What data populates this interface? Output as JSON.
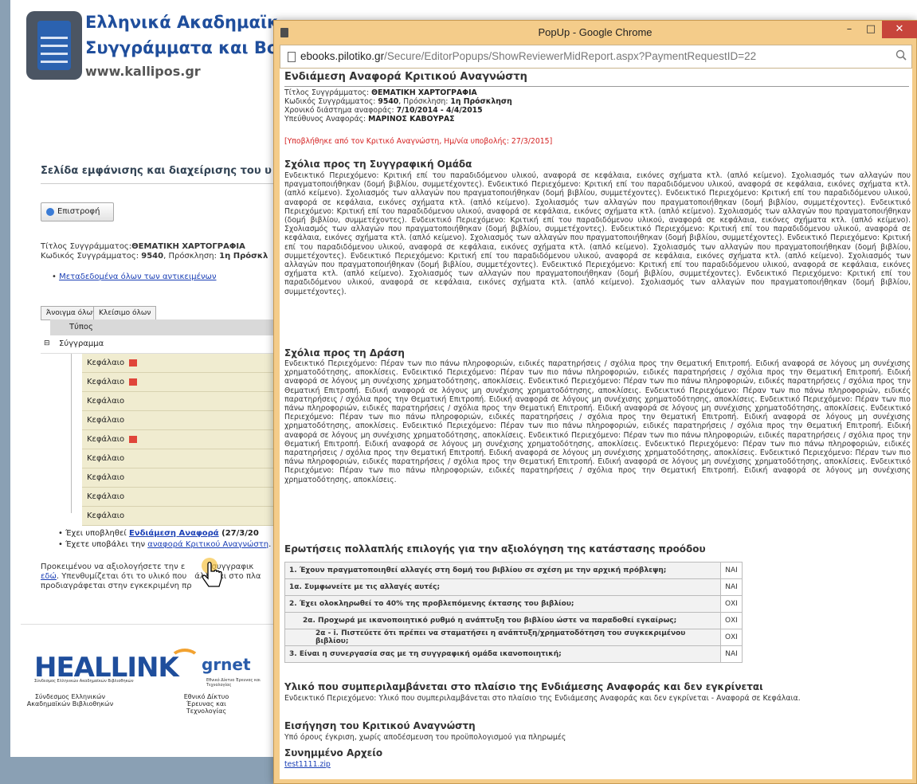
{
  "background": {
    "site_title_1": "Ελληνικά Ακαδημαϊκά Η",
    "site_title_2": "Συγγράμματα και Βοηθ",
    "site_url": "www.kallipos.gr",
    "heading": "Σελίδα εμφάνισης και διαχείρισης του υ",
    "back_button": "Επιστροφή",
    "title_label": "Τίτλος Συγγράμματος:",
    "title_value": "ΘΕΜΑΤΙΚΗ ΧΑΡΤΟΓΡΑΦΙΑ",
    "code_label": "Κωδικός Συγγράμματος: ",
    "code_value": "9540",
    "code_suffix": ", Πρόσκληση: ",
    "call_value": "1η Πρόσκλ",
    "metadata_link": "Μεταδεδομένα όλων των αντικειμένων",
    "open_all": "Άνοιγμα όλων",
    "close_all": "Κλείσιμο όλων",
    "col_type": "Τύπος",
    "root_item": "Σύγγραμμα",
    "chapters": [
      "Κεφάλαιο",
      "Κεφάλαιο",
      "Κεφάλαιο",
      "Κεφάλαιο",
      "Κεφάλαιο",
      "Κεφάλαιο",
      "Κεφάλαιο",
      "Κεφάλαιο",
      "Κεφάλαιο"
    ],
    "bullet1_prefix": "Έχει υποβληθεί ",
    "bullet1_link": "Ενδιάμεση Αναφορά",
    "bullet1_suffix": " (27/3/20",
    "bullet2_prefix": "Έχετε υποβάλει την ",
    "bullet2_link": "αναφορά Κριτικού Αναγνώστη",
    "bullet2_suffix": ". Μ",
    "para1": "Προκειμένου να αξιολογήσετε την ε",
    "para1b": " συγγραφικ",
    "para2_link": "εδώ",
    "para2": ". Υπενθυμίζεται ότι το υλικό που",
    "para2b": "άλλεται στο πλα",
    "para3": "προδιαγράφεται στην εγκεκριμένη πρ",
    "heal_brand": "HEALLINK",
    "heal_sub": "Σύνδεσμος Ελληνικών Ακαδημαϊκών Βιβλιοθηκών",
    "heal_label_1": "Σύνδεσμος Ελληνικών",
    "heal_label_2": "Ακαδημαϊκών Βιβλιοθηκών",
    "grnet_brand": "grnet",
    "grnet_sub": "Εθνικό Δίκτυο Έρευνας και Τεχνολογίας",
    "grnet_label_1": "Εθνικό Δίκτυο",
    "grnet_label_2": "Έρευνας και Τεχνολογίας"
  },
  "window": {
    "title": "PopUp - Google Chrome",
    "url_host": "ebooks.pilotiko.gr",
    "url_path": "/Secure/EditorPopups/ShowReviewerMidReport.aspx?PaymentRequestID=22",
    "minimize": "–",
    "maximize": "□",
    "close": "✕"
  },
  "report": {
    "title": "Ενδιάμεση Αναφορά Κριτικού Αναγνώστη",
    "book_title_label": "Τίτλος Συγγράμματος: ",
    "book_title": "ΘΕΜΑΤΙΚΗ ΧΑΡΤΟΓΡΑΦΙΑ",
    "book_code_label": "Κωδικός Συγγράμματος: ",
    "book_code": "9540",
    "call_label": ", Πρόσκληση: ",
    "call": "1η Πρόσκληση",
    "period_label": "Χρονικό διάστημα αναφοράς: ",
    "period": "7/10/2014 - 4/4/2015",
    "owner_label": "Υπεύθυνος Αναφοράς: ",
    "owner": "ΜΑΡΙΝΟΣ ΚΑΒΟΥΡΑΣ",
    "submitted_note": "[Υποβλήθηκε από τον Κριτικό Αναγνώστη, Ημ/νία υποβολής: 27/3/2015]",
    "section1_title": "Σχόλια προς τη Συγγραφική Ομάδα",
    "section1_text": "Ενδεικτικό Περιεχόμενο: Κριτική επί του παραδιδόμενου υλικού, αναφορά σε κεφάλαια, εικόνες σχήματα κτλ. (απλό κείμενο). Σχολιασμός των αλλαγών που πραγματοποιήθηκαν (δομή βιβλίου, συμμετέχοντες). Ενδεικτικό Περιεχόμενο: Κριτική επί του παραδιδόμενου υλικού, αναφορά σε κεφάλαια, εικόνες σχήματα κτλ. (απλό κείμενο). Σχολιασμός των αλλαγών που πραγματοποιήθηκαν (δομή βιβλίου, συμμετέχοντες). Ενδεικτικό Περιεχόμενο: Κριτική επί του παραδιδόμενου υλικού, αναφορά σε κεφάλαια, εικόνες σχήματα κτλ. (απλό κείμενο). Σχολιασμός των αλλαγών που πραγματοποιήθηκαν (δομή βιβλίου, συμμετέχοντες). Ενδεικτικό Περιεχόμενο: Κριτική επί του παραδιδόμενου υλικού, αναφορά σε κεφάλαια, εικόνες σχήματα κτλ. (απλό κείμενο). Σχολιασμός των αλλαγών που πραγματοποιήθηκαν (δομή βιβλίου, συμμετέχοντες). Ενδεικτικό Περιεχόμενο: Κριτική επί του παραδιδόμενου υλικού, αναφορά σε κεφάλαια, εικόνες σχήματα κτλ. (απλό κείμενο). Σχολιασμός των αλλαγών που πραγματοποιήθηκαν (δομή βιβλίου, συμμετέχοντες). Ενδεικτικό Περιεχόμενο: Κριτική επί του παραδιδόμενου υλικού, αναφορά σε κεφάλαια, εικόνες σχήματα κτλ. (απλό κείμενο). Σχολιασμός των αλλαγών που πραγματοποιήθηκαν (δομή βιβλίου, συμμετέχοντες). Ενδεικτικό Περιεχόμενο: Κριτική επί του παραδιδόμενου υλικού, αναφορά σε κεφάλαια, εικόνες σχήματα κτλ. (απλό κείμενο). Σχολιασμός των αλλαγών που πραγματοποιήθηκαν (δομή βιβλίου, συμμετέχοντες). Ενδεικτικό Περιεχόμενο: Κριτική επί του παραδιδόμενου υλικού, αναφορά σε κεφάλαια, εικόνες σχήματα κτλ. (απλό κείμενο). Σχολιασμός των αλλαγών που πραγματοποιήθηκαν (δομή βιβλίου, συμμετέχοντες). Ενδεικτικό Περιεχόμενο: Κριτική επί του παραδιδόμενου υλικού, αναφορά σε κεφάλαια, εικόνες σχήματα κτλ. (απλό κείμενο). Σχολιασμός των αλλαγών που πραγματοποιήθηκαν (δομή βιβλίου, συμμετέχοντες). Ενδεικτικό Περιεχόμενο: Κριτική επί του παραδιδόμενου υλικού, αναφορά σε κεφάλαια, εικόνες σχήματα κτλ. (απλό κείμενο). Σχολιασμός των αλλαγών που πραγματοποιήθηκαν (δομή βιβλίου, συμμετέχοντες).",
    "section2_title": "Σχόλια προς τη Δράση",
    "section2_text": "Ενδεικτικό Περιεχόμενο: Πέραν των πιο πάνω πληροφοριών, ειδικές παρατηρήσεις / σχόλια προς την Θεματική Επιτροπή. Ειδική αναφορά σε λόγους μη συνέχισης χρηματοδότησης, αποκλίσεις. Ενδεικτικό Περιεχόμενο: Πέραν των πιο πάνω πληροφοριών, ειδικές παρατηρήσεις / σχόλια προς την Θεματική Επιτροπή. Ειδική αναφορά σε λόγους μη συνέχισης χρηματοδότησης, αποκλίσεις. Ενδεικτικό Περιεχόμενο: Πέραν των πιο πάνω πληροφοριών, ειδικές παρατηρήσεις / σχόλια προς την Θεματική Επιτροπή. Ειδική αναφορά σε λόγους μη συνέχισης χρηματοδότησης, αποκλίσεις. Ενδεικτικό Περιεχόμενο: Πέραν των πιο πάνω πληροφοριών, ειδικές παρατηρήσεις / σχόλια προς την Θεματική Επιτροπή. Ειδική αναφορά σε λόγους μη συνέχισης χρηματοδότησης, αποκλίσεις. Ενδεικτικό Περιεχόμενο: Πέραν των πιο πάνω πληροφοριών, ειδικές παρατηρήσεις / σχόλια προς την Θεματική Επιτροπή. Ειδική αναφορά σε λόγους μη συνέχισης χρηματοδότησης, αποκλίσεις. Ενδεικτικό Περιεχόμενο: Πέραν των πιο πάνω πληροφοριών, ειδικές παρατηρήσεις / σχόλια προς την Θεματική Επιτροπή. Ειδική αναφορά σε λόγους μη συνέχισης χρηματοδότησης, αποκλίσεις. Ενδεικτικό Περιεχόμενο: Πέραν των πιο πάνω πληροφοριών, ειδικές παρατηρήσεις / σχόλια προς την Θεματική Επιτροπή. Ειδική αναφορά σε λόγους μη συνέχισης χρηματοδότησης, αποκλίσεις. Ενδεικτικό Περιεχόμενο: Πέραν των πιο πάνω πληροφοριών, ειδικές παρατηρήσεις / σχόλια προς την Θεματική Επιτροπή. Ειδική αναφορά σε λόγους μη συνέχισης χρηματοδότησης, αποκλίσεις. Ενδεικτικό Περιεχόμενο: Πέραν των πιο πάνω πληροφοριών, ειδικές παρατηρήσεις / σχόλια προς την Θεματική Επιτροπή. Ειδική αναφορά σε λόγους μη συνέχισης χρηματοδότησης, αποκλίσεις. Ενδεικτικό Περιεχόμενο: Πέραν των πιο πάνω πληροφοριών, ειδικές παρατηρήσεις / σχόλια προς την Θεματική Επιτροπή. Ειδική αναφορά σε λόγους μη συνέχισης χρηματοδότησης, αποκλίσεις. Ενδεικτικό Περιεχόμενο: Πέραν των πιο πάνω πληροφοριών, ειδικές παρατηρήσεις / σχόλια προς την Θεματική Επιτροπή. Ειδική αναφορά σε λόγους μη συνέχισης χρηματοδότησης, αποκλίσεις.",
    "section3_title": "Ερωτήσεις πολλαπλής επιλογής για την αξιολόγηση της κατάστασης προόδου",
    "questions": [
      {
        "q": "1. Έχουν πραγματοποιηθεί αλλαγές στη δομή του βιβλίου σε σχέση με την αρχική πρόβλεψη;",
        "a": "ΝΑΙ"
      },
      {
        "q": "1α. Συμφωνείτε με τις αλλαγές αυτές;",
        "a": "ΝΑΙ"
      },
      {
        "q": "2. Έχει ολοκληρωθεί το 40% της προβλεπόμενης έκτασης του βιβλίου;",
        "a": "ΟΧΙ"
      },
      {
        "q": "2α. Προχωρά με ικανοποιητικό ρυθμό η ανάπτυξη του βιβλίου ώστε να παραδοθεί εγκαίρως;",
        "a": "ΟΧΙ"
      },
      {
        "q": "2α - i. Πιστεύετε ότι πρέπει να σταματήσει η ανάπτυξη/χρηματοδότηση του συγκεκριμένου βιβλίου;",
        "a": "ΟΧΙ"
      },
      {
        "q": "3. Είναι η συνεργασία σας με τη συγγραφική ομάδα ικανοποιητική;",
        "a": "ΝΑΙ"
      }
    ],
    "section4_title": "Υλικό που συμπεριλαμβάνεται στο πλαίσιο της Ενδιάμεσης Αναφοράς και δεν εγκρίνεται",
    "section4_text": "Ενδεικτικό Περιεχόμενο: Υλικό που συμπεριλαμβάνεται στο πλαίσιο της Ενδιάμεσης Αναφοράς και δεν εγκρίνεται - Αναφορά σε Κεφάλαια.",
    "section5_title": "Εισήγηση του Κριτικού Αναγνώστη",
    "section5_text": "Υπό όρους έγκριση, χωρίς αποδέσμευση του προϋπολογισμού για πληρωμές",
    "section6_title": "Συνημμένο Αρχείο",
    "attachment": "test1111.zip"
  }
}
